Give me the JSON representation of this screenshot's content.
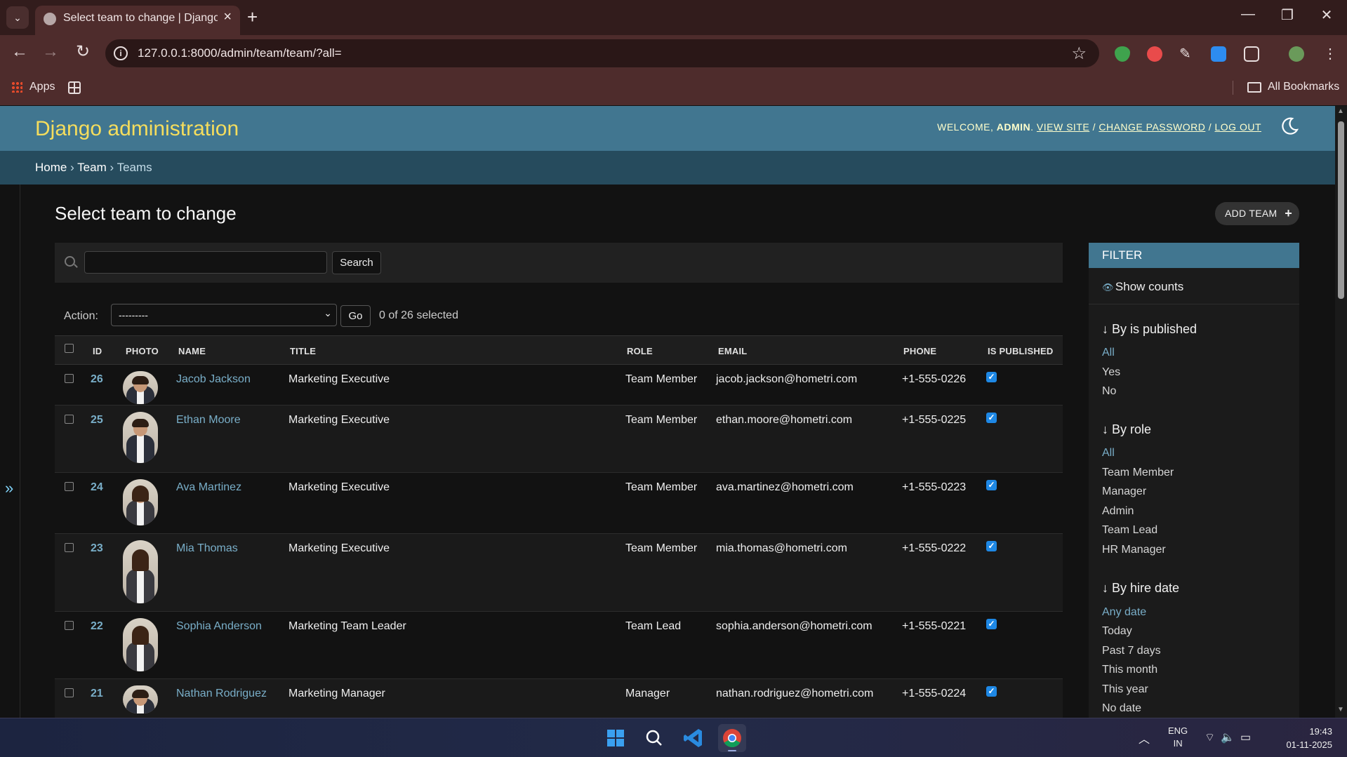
{
  "browser": {
    "tab_title": "Select team to change | Django",
    "url": "127.0.0.1:8000/admin/team/team/?all=",
    "bookmarks": {
      "apps": "Apps",
      "all_bookmarks": "All Bookmarks"
    }
  },
  "header": {
    "branding": "Django administration",
    "welcome": "WELCOME,",
    "user": "ADMIN",
    "view_site": "VIEW SITE",
    "change_password": "CHANGE PASSWORD",
    "log_out": "LOG OUT"
  },
  "breadcrumbs": [
    "Home",
    "Team",
    "Teams"
  ],
  "page": {
    "title": "Select team to change",
    "add_button": "ADD TEAM",
    "search_button": "Search",
    "search_value": "",
    "action_label": "Action:",
    "action_value": "---------",
    "go_button": "Go",
    "selected_count": "0 of 26 selected"
  },
  "table": {
    "columns": [
      "ID",
      "PHOTO",
      "NAME",
      "TITLE",
      "ROLE",
      "EMAIL",
      "PHONE",
      "IS PUBLISHED"
    ],
    "rows": [
      {
        "id": "26",
        "name": "Jacob Jackson",
        "title": "Marketing Executive",
        "role": "Team Member",
        "email": "jacob.jackson@hometri.com",
        "phone": "+1-555-0226",
        "published": true
      },
      {
        "id": "25",
        "name": "Ethan Moore",
        "title": "Marketing Executive",
        "role": "Team Member",
        "email": "ethan.moore@hometri.com",
        "phone": "+1-555-0225",
        "published": true
      },
      {
        "id": "24",
        "name": "Ava Martinez",
        "title": "Marketing Executive",
        "role": "Team Member",
        "email": "ava.martinez@hometri.com",
        "phone": "+1-555-0223",
        "published": true
      },
      {
        "id": "23",
        "name": "Mia Thomas",
        "title": "Marketing Executive",
        "role": "Team Member",
        "email": "mia.thomas@hometri.com",
        "phone": "+1-555-0222",
        "published": true
      },
      {
        "id": "22",
        "name": "Sophia Anderson",
        "title": "Marketing Team Leader",
        "role": "Team Lead",
        "email": "sophia.anderson@hometri.com",
        "phone": "+1-555-0221",
        "published": true
      },
      {
        "id": "21",
        "name": "Nathan Rodriguez",
        "title": "Marketing Manager",
        "role": "Manager",
        "email": "nathan.rodriguez@hometri.com",
        "phone": "+1-555-0224",
        "published": true
      }
    ]
  },
  "filter": {
    "heading": "FILTER",
    "show_counts": "Show counts",
    "groups": [
      {
        "title": "↓ By is published",
        "items": [
          "All",
          "Yes",
          "No"
        ],
        "selected": 0
      },
      {
        "title": "↓ By role",
        "items": [
          "All",
          "Team Member",
          "Manager",
          "Admin",
          "Team Lead",
          "HR Manager"
        ],
        "selected": 0
      },
      {
        "title": "↓ By hire date",
        "items": [
          "Any date",
          "Today",
          "Past 7 days",
          "This month",
          "This year",
          "No date"
        ],
        "selected": 0
      }
    ]
  },
  "taskbar": {
    "lang_1": "ENG",
    "lang_2": "IN",
    "time": "19:43",
    "date": "01-11-2025"
  },
  "colors": {
    "accent": "#79aec8",
    "header": "#417690",
    "breadcrumbs": "#264b5d",
    "branding": "#f5dd5d"
  }
}
